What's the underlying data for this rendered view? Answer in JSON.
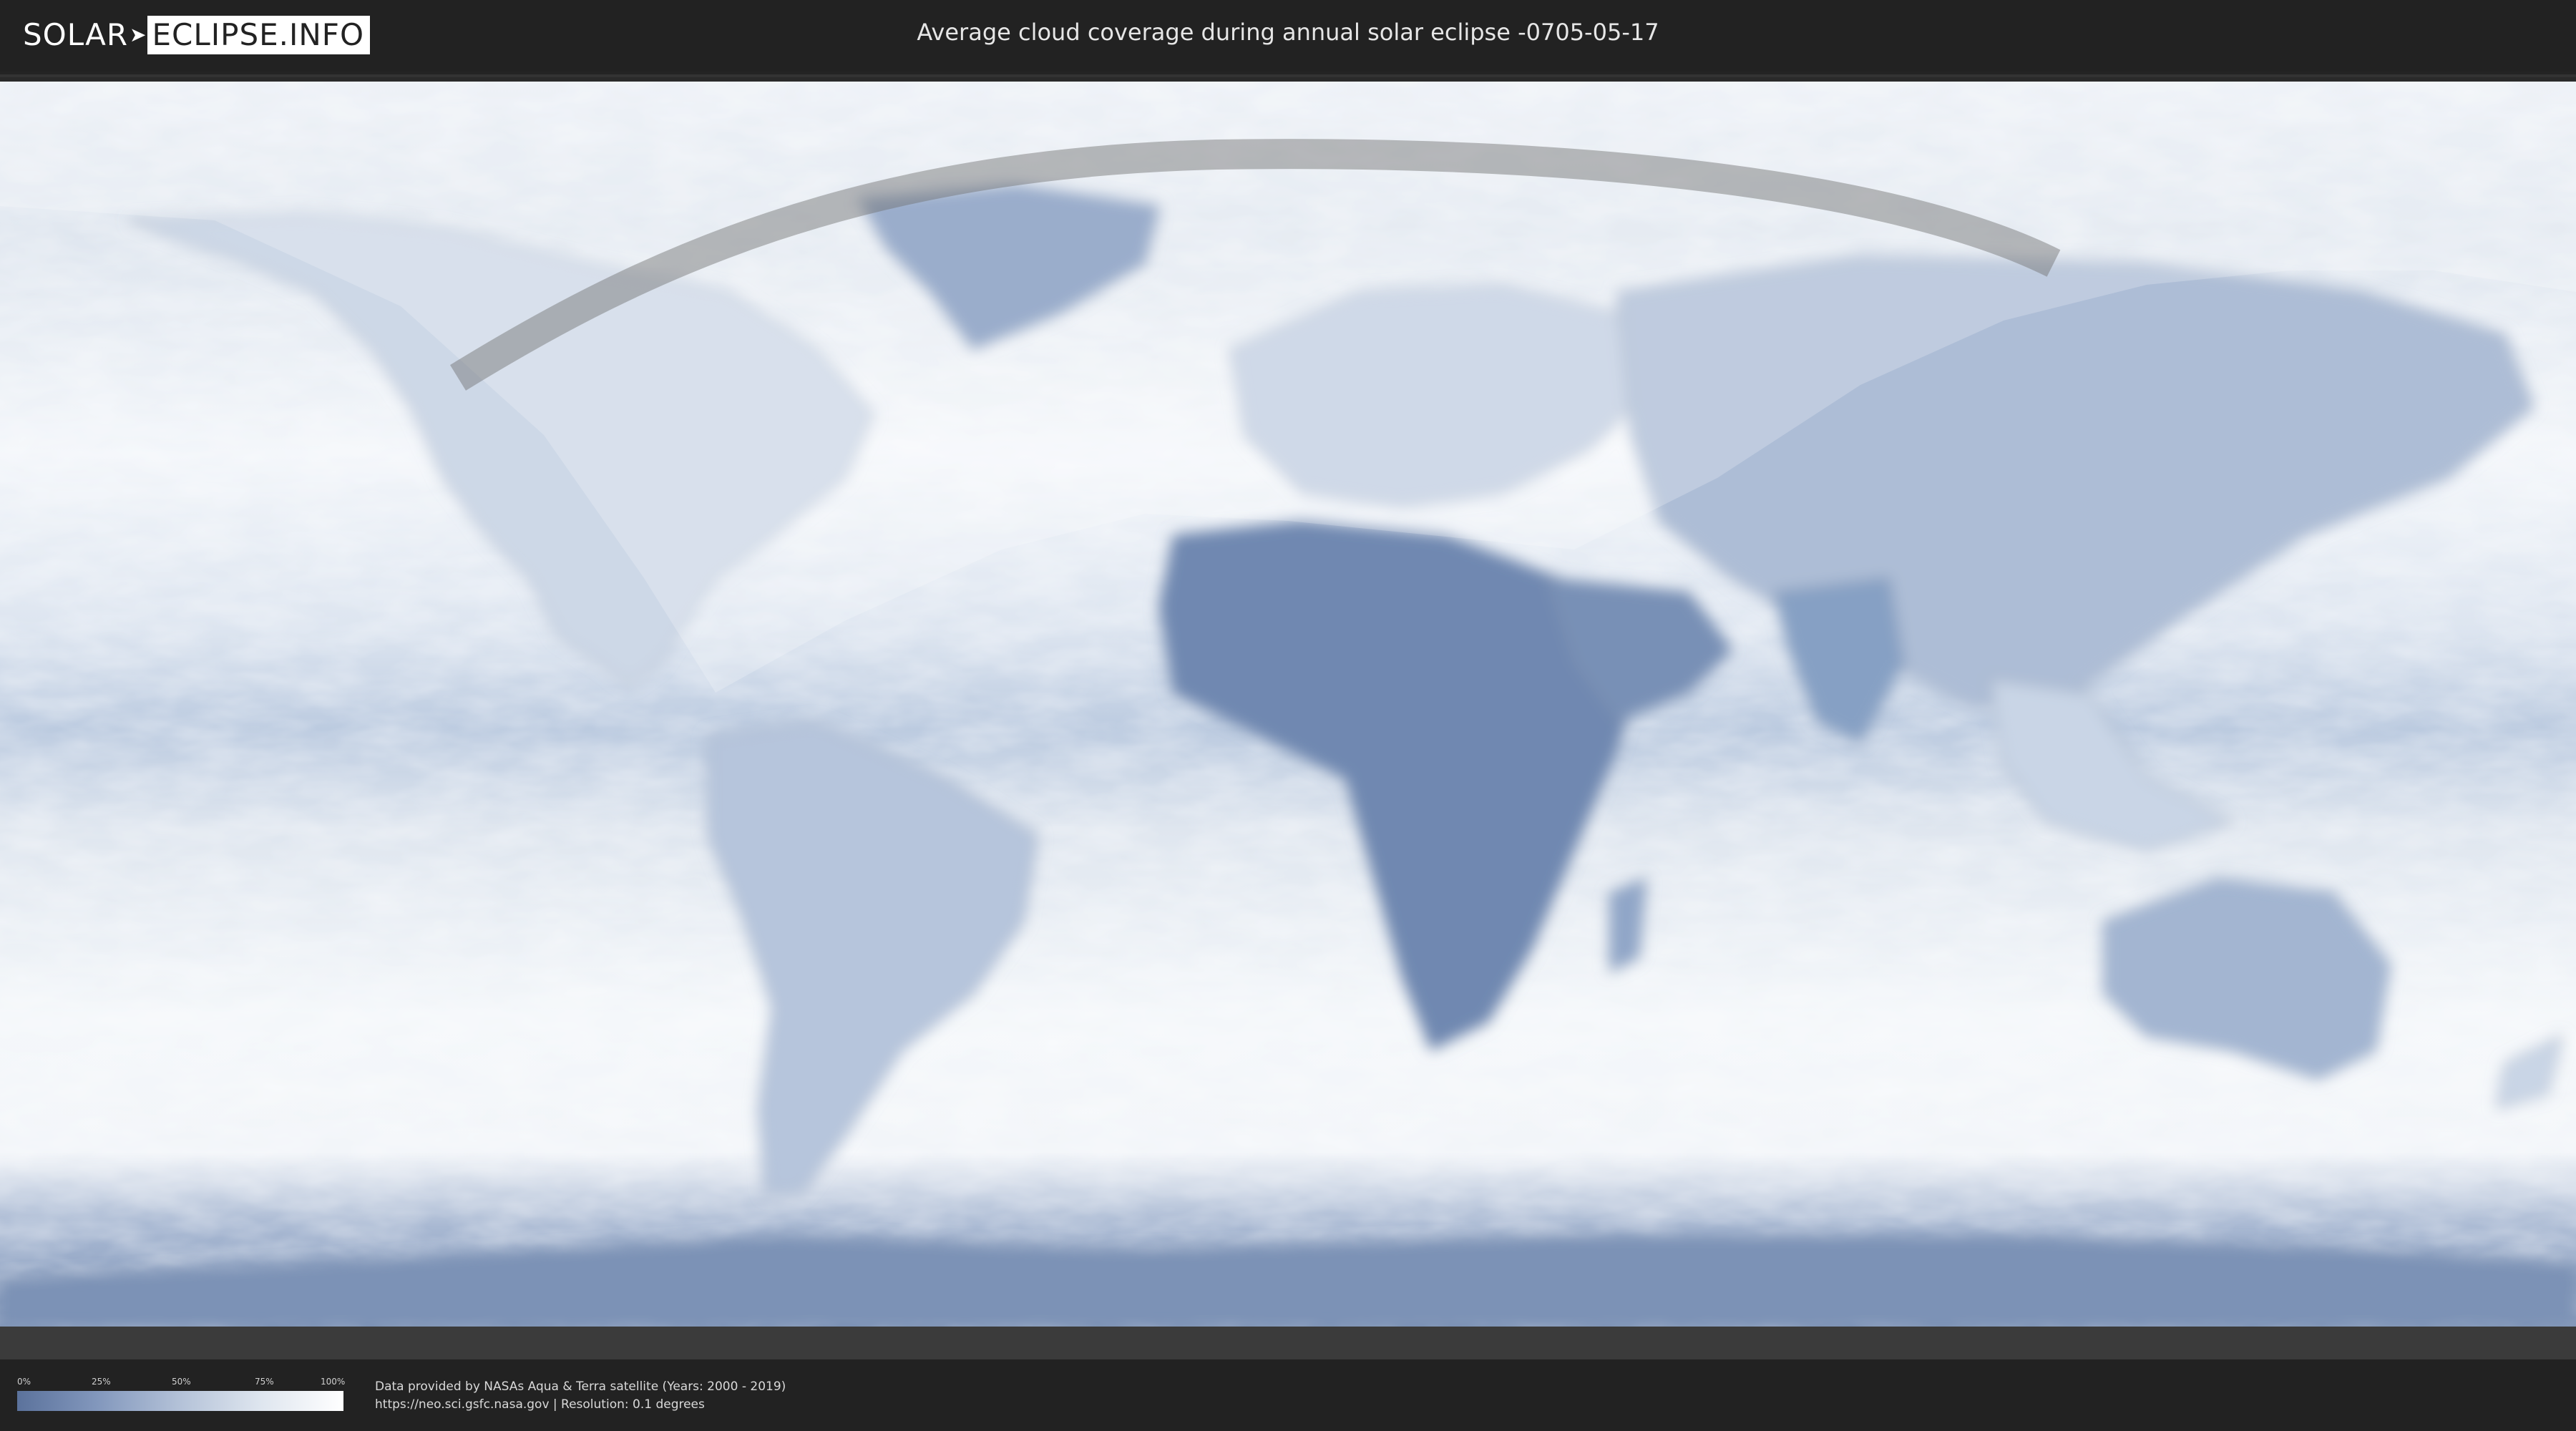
{
  "header": {
    "logo_part1": "SOLAR",
    "logo_part2": "ECLIPSE.INFO",
    "title": "Average cloud coverage during annual solar eclipse -0705-05-17"
  },
  "map": {
    "projection": "equirectangular",
    "colors": {
      "cloud_clear": "#5b729c",
      "cloud_full": "#ffffff",
      "eclipse_path": "#7c7c7c",
      "visibility_overlay": "#ffffff"
    }
  },
  "legend": {
    "ticks": [
      "0%",
      "25%",
      "50%",
      "75%",
      "100%"
    ]
  },
  "credits": {
    "line1": "Data provided by NASAs Aqua & Terra satellite (Years: 2000 - 2019)",
    "line2": "https://neo.sci.gsfc.nasa.gov | Resolution: 0.1 degrees"
  }
}
